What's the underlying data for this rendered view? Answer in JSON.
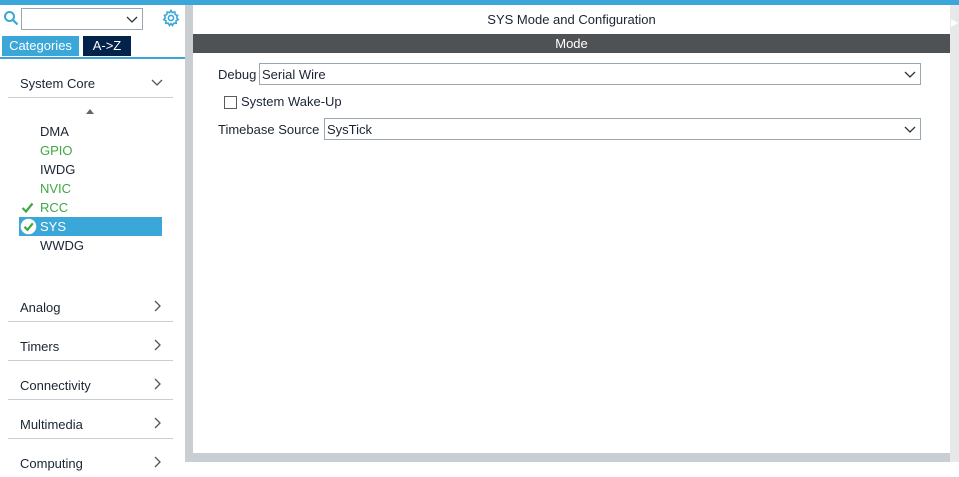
{
  "left_panel": {
    "search": {
      "value": ""
    },
    "tabs": [
      {
        "label": "Categories",
        "active": true
      },
      {
        "label": "A->Z",
        "active": false
      }
    ],
    "categories": [
      {
        "label": "System Core",
        "expanded": true
      },
      {
        "label": "Analog",
        "expanded": false
      },
      {
        "label": "Timers",
        "expanded": false
      },
      {
        "label": "Connectivity",
        "expanded": false
      },
      {
        "label": "Multimedia",
        "expanded": false
      },
      {
        "label": "Computing",
        "expanded": false
      }
    ],
    "system_core_items": [
      {
        "label": "DMA",
        "status": "none"
      },
      {
        "label": "GPIO",
        "status": "configured"
      },
      {
        "label": "IWDG",
        "status": "none"
      },
      {
        "label": "NVIC",
        "status": "configured"
      },
      {
        "label": "RCC",
        "status": "check"
      },
      {
        "label": "SYS",
        "status": "selected"
      },
      {
        "label": "WWDG",
        "status": "none"
      }
    ]
  },
  "right_panel": {
    "title": "SYS Mode and Configuration",
    "section": "Mode",
    "debug": {
      "label": "Debug",
      "value": "Serial Wire"
    },
    "wakeup": {
      "label": "System Wake-Up",
      "checked": false
    },
    "timebase": {
      "label": "Timebase Source",
      "value": "SysTick"
    }
  },
  "colors": {
    "accent": "#3aa7d8",
    "dark_tab": "#03234b",
    "mode_bar": "#4f5254",
    "configured_green": "#3fa744"
  },
  "icons": [
    "search-icon",
    "chevron-down-icon",
    "gear-icon",
    "sort-up-icon",
    "chevron-right-icon",
    "check-icon",
    "check-circle-icon"
  ]
}
